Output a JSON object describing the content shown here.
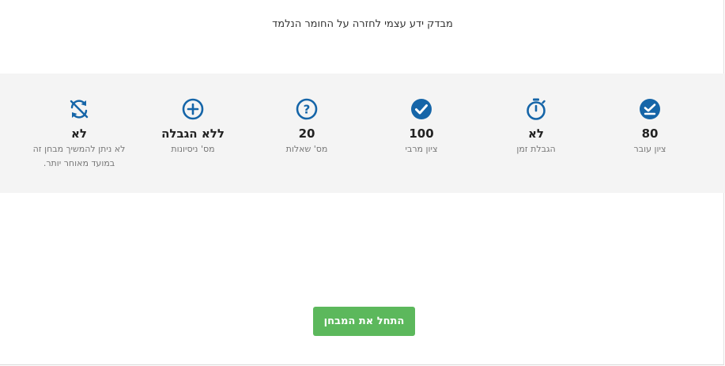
{
  "header": {
    "subtitle": "מבדק ידע עצמי לחזרה על החומר הנלמד"
  },
  "colors": {
    "accent": "#1565a8",
    "band": "#f4f4f4",
    "button": "#5cb85c"
  },
  "stats": [
    {
      "icon": "check-underline-icon",
      "value": "80",
      "label": "ציון עובר"
    },
    {
      "icon": "stopwatch-icon",
      "value": "לא",
      "label": "הגבלת זמן"
    },
    {
      "icon": "check-circle-icon",
      "value": "100",
      "label": "ציון מרבי"
    },
    {
      "icon": "question-circle-icon",
      "value": "20",
      "label": "מס' שאלות"
    },
    {
      "icon": "plus-circle-icon",
      "value": "ללא הגבלה",
      "label": "מס' ניסיונות"
    },
    {
      "icon": "no-resume-icon",
      "value": "לא",
      "label": "לא ניתן להמשיך מבחן זה במועד מאוחר יותר."
    }
  ],
  "actions": {
    "start_label": "התחל את המבחן"
  }
}
